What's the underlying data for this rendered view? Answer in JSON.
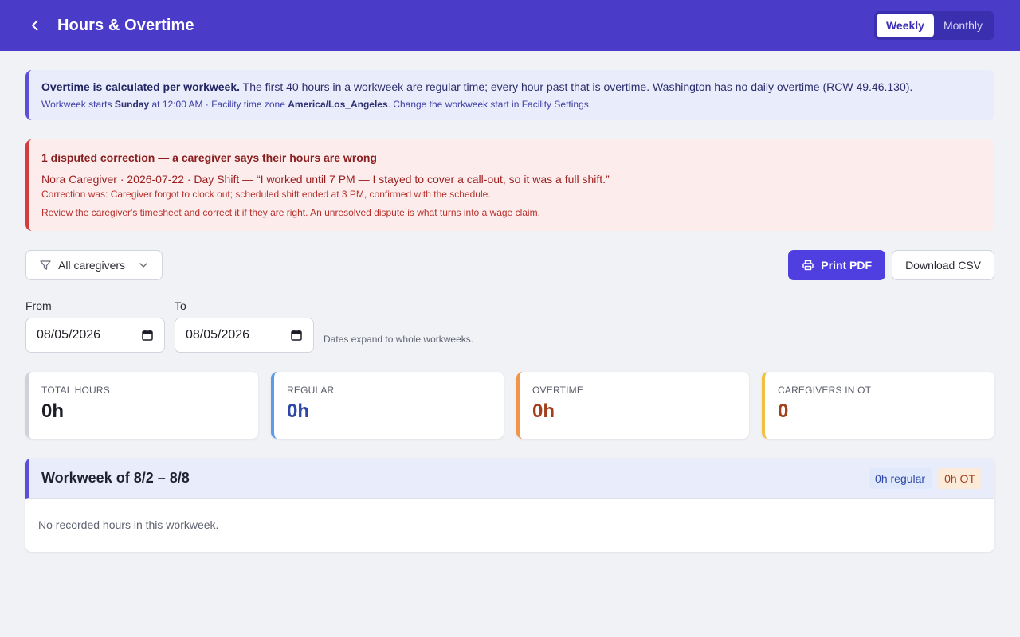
{
  "header": {
    "title": "Hours & Overtime",
    "toggle": {
      "weekly": "Weekly",
      "monthly": "Monthly",
      "active": "Weekly"
    }
  },
  "info": {
    "bold": "Overtime is calculated per workweek.",
    "text": "The first 40 hours in a workweek are regular time; every hour past that is overtime. Washington has no daily overtime (RCW 49.46.130).",
    "line2_prefix": "Workweek starts",
    "start_day": "Sunday",
    "line2_mid": "at 12:00 AM · Facility time zone",
    "timezone": "America/Los_Angeles",
    "line2_suffix": ". Change the workweek start in Facility Settings."
  },
  "dispute": {
    "title": "1 disputed correction — a caregiver says their hours are wrong",
    "line": "Nora Caregiver · 2026-07-22 · Day Shift — “I worked until 7 PM — I stayed to cover a call-out, so it was a full shift.”",
    "note": "Correction was: Caregiver forgot to clock out; scheduled shift ended at 3 PM, confirmed with the schedule.",
    "review": "Review the caregiver's timesheet and correct it if they are right. An unresolved dispute is what turns into a wage claim."
  },
  "toolbar": {
    "filter_label": "All caregivers",
    "print_label": "Print PDF",
    "csv_label": "Download CSV"
  },
  "dates": {
    "from_label": "From",
    "from_value": "08/05/2026",
    "to_label": "To",
    "to_value": "08/05/2026",
    "hint": "Dates expand to whole workweeks."
  },
  "stats": [
    {
      "label": "TOTAL HOURS",
      "value": "0h",
      "color": "#1c1d26",
      "accent": "#cfd2dc"
    },
    {
      "label": "REGULAR",
      "value": "0h",
      "color": "#2f47a8",
      "accent": "#5b9be8"
    },
    {
      "label": "OVERTIME",
      "value": "0h",
      "color": "#a3401c",
      "accent": "#f1954a"
    },
    {
      "label": "CAREGIVERS IN OT",
      "value": "0",
      "color": "#a3401c",
      "accent": "#f0c040"
    }
  ],
  "workweek": {
    "title": "Workweek of 8/2 – 8/8",
    "regular_badge": "0h regular",
    "ot_badge": "0h OT",
    "empty": "No recorded hours in this workweek."
  },
  "colors": {
    "brand": "#4a3bc9",
    "primary_button": "#4f3fe0",
    "dispute_accent": "#d43b3b",
    "regular_badge_bg": "#dfe9fb",
    "regular_badge_fg": "#2f47a8",
    "ot_badge_bg": "#fcebd9",
    "ot_badge_fg": "#a3401c"
  }
}
